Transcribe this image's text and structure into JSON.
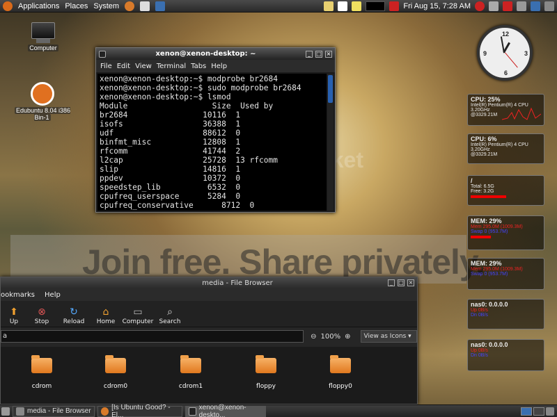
{
  "top_panel": {
    "menus": [
      "Applications",
      "Places",
      "System"
    ],
    "clock": "Fri Aug 15,  7:28 AM"
  },
  "desktop": {
    "icons": [
      {
        "label": "Computer"
      },
      {
        "label": "Edubuntu 8.04 i386 Bin-1"
      }
    ]
  },
  "terminal": {
    "title": "xenon@xenon-desktop: ~",
    "menu": [
      "File",
      "Edit",
      "View",
      "Terminal",
      "Tabs",
      "Help"
    ],
    "lines": [
      "xenon@xenon-desktop:~$ modprobe br2684",
      "xenon@xenon-desktop:~$ sudo modprobe br2684",
      "xenon@xenon-desktop:~$ lsmod",
      "Module                  Size  Used by",
      "br2684                10116  1",
      "isofs                 36388  1",
      "udf                   88612  0",
      "binfmt_misc           12808  1",
      "rfcomm                41744  2",
      "l2cap                 25728  13 rfcomm",
      "slip                  14816  1",
      "ppdev                 10372  0",
      "speedstep_lib          6532  0",
      "cpufreq_userspace      5284  0",
      "cpufreq_conservative      8712  0"
    ]
  },
  "watermark": {
    "main": "Join free. Share privately.",
    "brand": "photobucket"
  },
  "file_browser": {
    "title": "media - File Browser",
    "menu": [
      "ookmarks",
      "Help"
    ],
    "toolbar": [
      "Up",
      "Stop",
      "Reload",
      "Home",
      "Computer",
      "Search"
    ],
    "location": "a",
    "zoom": "100%",
    "view": "View as Icons",
    "files": [
      "cdrom",
      "cdrom0",
      "cdrom1",
      "floppy",
      "floppy0"
    ]
  },
  "clock_widget": {
    "numbers": [
      "12",
      "3",
      "6",
      "9"
    ]
  },
  "conky": [
    {
      "header": "CPU: 25%",
      "lines": [
        "Intel(R) Pentium(R) 4 CPU",
        "3.20GHz",
        "@3329.21M"
      ]
    },
    {
      "header": "CPU: 6%",
      "lines": [
        "Intel(R) Pentium(R) 4 CPU",
        "3.20GHz",
        "@3329.21M"
      ]
    },
    {
      "header": "/",
      "lines": [
        "Total: 6.5G",
        "Free: 3.2G"
      ]
    },
    {
      "header": "MEM: 29%",
      "lines": [
        "Mem 295.0M (1009.3M)",
        "Swap 0 (953.7M)"
      ]
    },
    {
      "header": "MEM: 29%",
      "lines": [
        "Mem 295.0M (1009.3M)",
        "Swap 0 (953.7M)"
      ]
    },
    {
      "header": "nas0: 0.0.0.0",
      "lines": [
        "Up  0B/s",
        "Dn  0B/s"
      ]
    },
    {
      "header": "nas0: 0.0.0.0",
      "lines": [
        "Up  0B/s",
        "Dn  0B/s"
      ]
    }
  ],
  "taskbar": {
    "tasks": [
      "media - File Browser",
      "[Is Ubuntu Good? - El...",
      "xenon@xenon-deskto..."
    ]
  }
}
